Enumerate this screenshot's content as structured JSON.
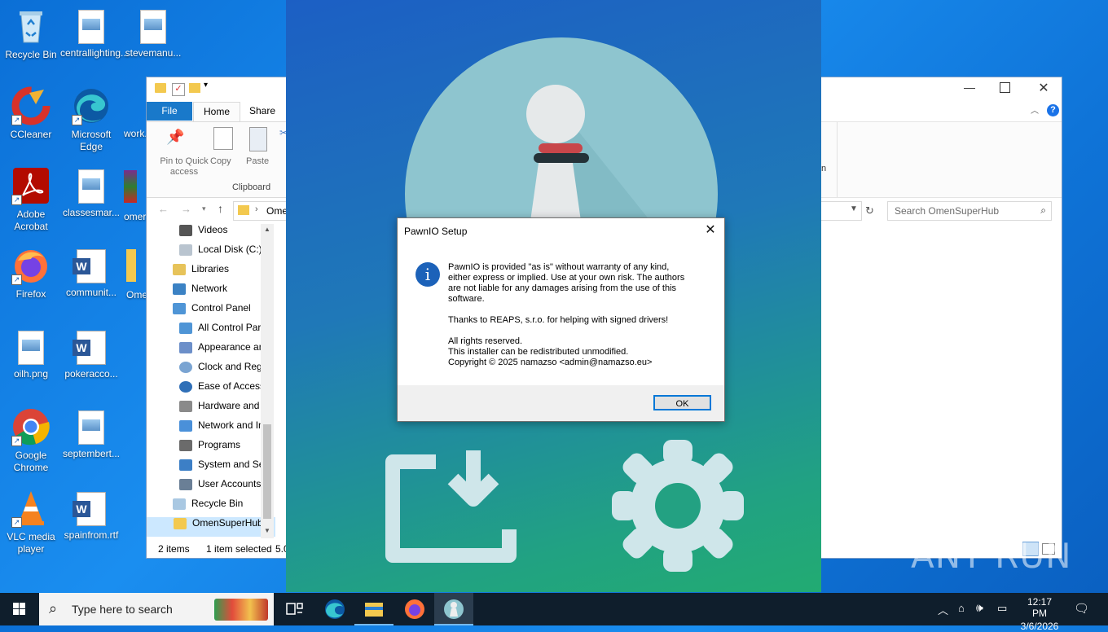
{
  "desktop": {
    "icons": [
      {
        "label": "Recycle Bin"
      },
      {
        "label": "centrallighting..."
      },
      {
        "label": "stevemanu..."
      },
      {
        "label": "CCleaner"
      },
      {
        "label": "Microsoft Edge"
      },
      {
        "label": "work..."
      },
      {
        "label": "Adobe Acrobat"
      },
      {
        "label": "classesmar..."
      },
      {
        "label": "omer..."
      },
      {
        "label": "Firefox"
      },
      {
        "label": "communit..."
      },
      {
        "label": "Ome..."
      },
      {
        "label": "oilh.png"
      },
      {
        "label": "pokeracco..."
      },
      {
        "label": "Google Chrome"
      },
      {
        "label": "septembert..."
      },
      {
        "label": "VLC media player"
      },
      {
        "label": "spainfrom.rtf"
      }
    ]
  },
  "explorer": {
    "tabs": [
      "File",
      "Home",
      "Share"
    ],
    "ribbon": {
      "pin": "Pin to Quick access",
      "copy": "Copy",
      "paste": "Paste",
      "group": "Clipboard"
    },
    "address": "Omen",
    "search_placeholder": "Search OmenSuperHub",
    "nav": [
      "Videos",
      "Local Disk (C:)",
      "Libraries",
      "Network",
      "Control Panel",
      "All Control Par",
      "Appearance an",
      "Clock and Regi",
      "Ease of Access",
      "Hardware and",
      "Network and In",
      "Programs",
      "System and Se",
      "User Accounts",
      "Recycle Bin",
      "OmenSuperHub"
    ],
    "status_items": "2 items",
    "status_selected": "1 item selected",
    "status_size": "5.0",
    "right_partial": "n"
  },
  "dialog": {
    "title": "PawnIO Setup",
    "message1": "PawnIO is provided \"as is\" without warranty of any kind,\neither express or implied. Use at your own risk. The authors\nare not liable for any damages arising from the use of this\nsoftware.",
    "message2": "Thanks to REAPS, s.r.o. for helping with signed drivers!",
    "message3": "All rights reserved.\nThis installer can be redistributed unmodified.\nCopyright © 2025 namazso <admin@namazso.eu>",
    "ok": "OK"
  },
  "taskbar": {
    "search": "Type here to search",
    "time": "12:17 PM",
    "date": "3/6/2026"
  },
  "watermark": "ANY RUN",
  "colors": {
    "accent": "#0078d7",
    "taskbar": "#0f1e2c",
    "installer_top": "#1c5fc4",
    "installer_bottom": "#22ab72"
  }
}
